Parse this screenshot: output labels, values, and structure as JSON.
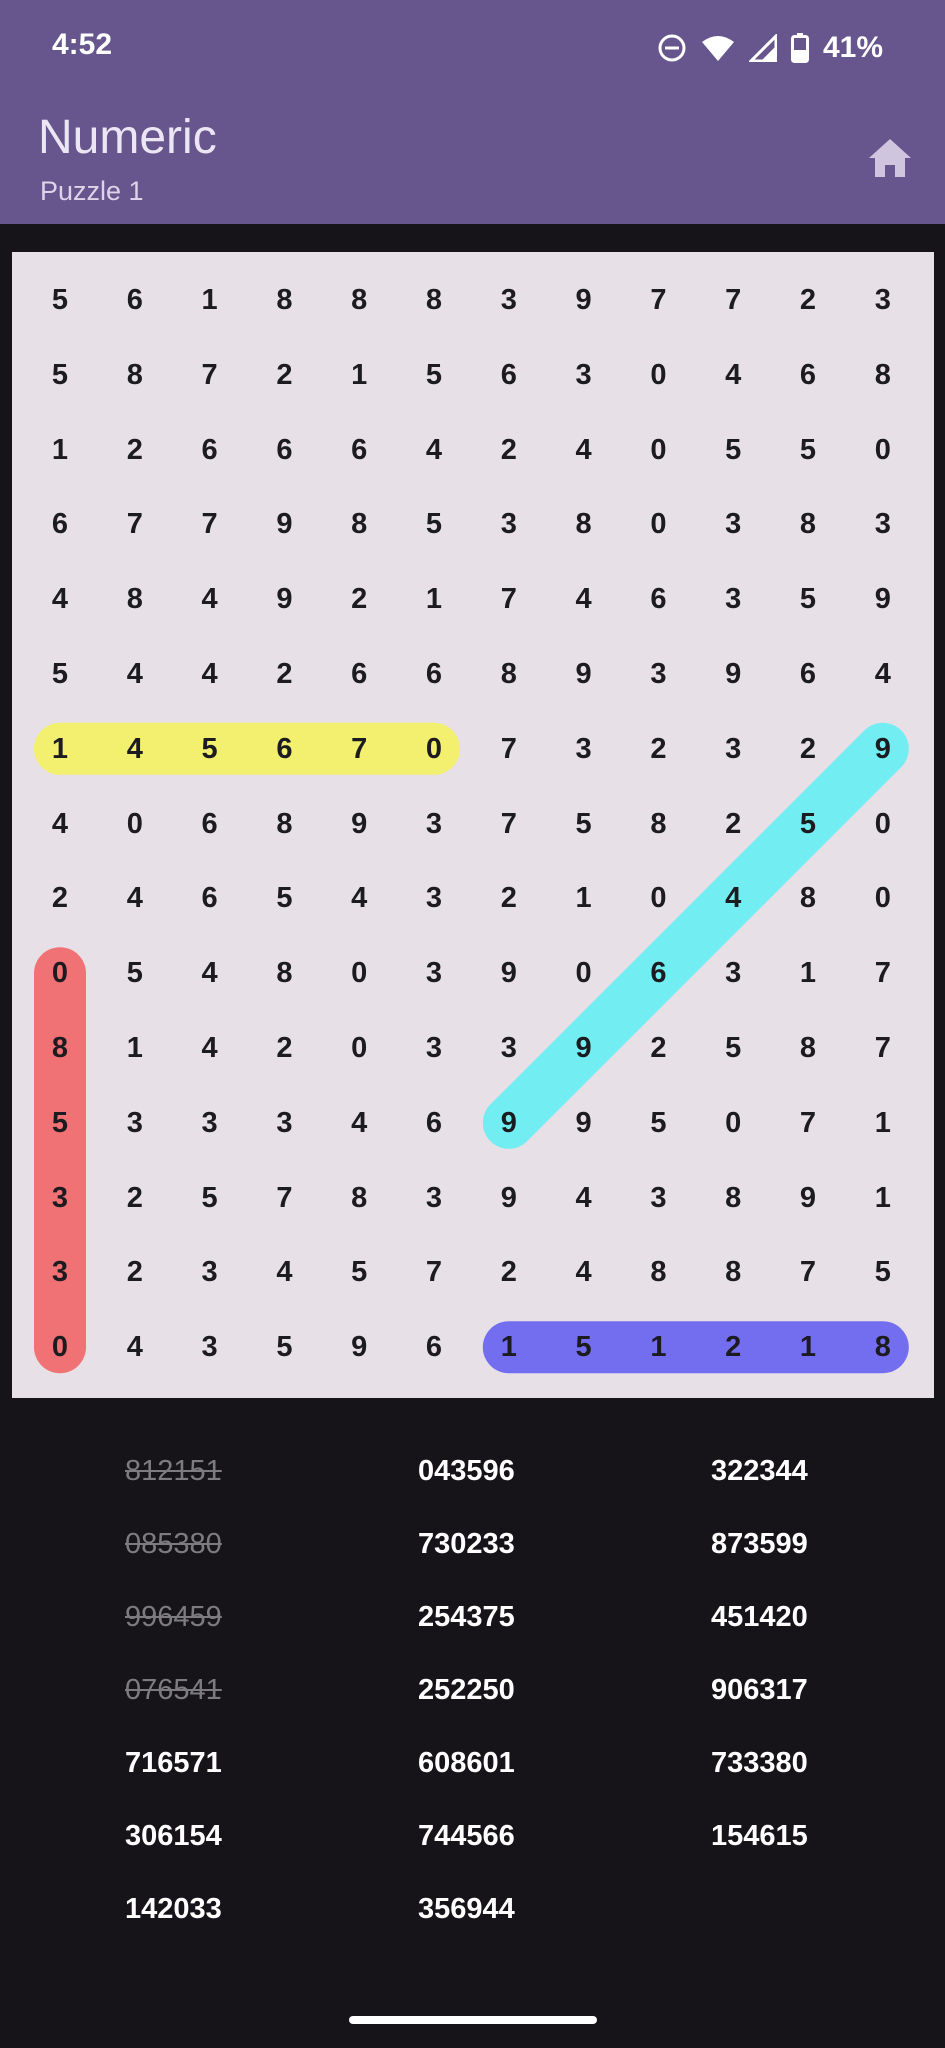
{
  "status_bar": {
    "time": "4:52",
    "battery": "41%"
  },
  "app_bar": {
    "title": "Numeric",
    "subtitle": "Puzzle 1",
    "home_icon": "home-icon"
  },
  "grid": {
    "rows": [
      "561888397723",
      "587215630468",
      "126664240550",
      "677985380383",
      "484921746359",
      "544266893964",
      "145670732329",
      "406893758250",
      "246543210480",
      "054803906317",
      "814203392587",
      "533346995071",
      "325783943891",
      "323457248875",
      "043596151218"
    ],
    "highlights": [
      {
        "word": "145670",
        "start": [
          6,
          0
        ],
        "end": [
          6,
          5
        ],
        "color": "#f2f06e"
      },
      {
        "word": "996459",
        "start": [
          11,
          6
        ],
        "end": [
          6,
          11
        ],
        "color": "#72eef2"
      },
      {
        "word": "085380",
        "start": [
          9,
          0
        ],
        "end": [
          14,
          0
        ],
        "color": "#f07274"
      },
      {
        "word": "151218",
        "start": [
          14,
          6
        ],
        "end": [
          14,
          11
        ],
        "color": "#736ef0"
      }
    ]
  },
  "words": [
    [
      {
        "text": "812151",
        "found": true
      },
      {
        "text": "085380",
        "found": true
      },
      {
        "text": "996459",
        "found": true
      },
      {
        "text": "076541",
        "found": true
      },
      {
        "text": "716571",
        "found": false
      },
      {
        "text": "306154",
        "found": false
      },
      {
        "text": "142033",
        "found": false
      }
    ],
    [
      {
        "text": "043596",
        "found": false
      },
      {
        "text": "730233",
        "found": false
      },
      {
        "text": "254375",
        "found": false
      },
      {
        "text": "252250",
        "found": false
      },
      {
        "text": "608601",
        "found": false
      },
      {
        "text": "744566",
        "found": false
      },
      {
        "text": "356944",
        "found": false
      }
    ],
    [
      {
        "text": "322344",
        "found": false
      },
      {
        "text": "873599",
        "found": false
      },
      {
        "text": "451420",
        "found": false
      },
      {
        "text": "906317",
        "found": false
      },
      {
        "text": "733380",
        "found": false
      },
      {
        "text": "154615",
        "found": false
      }
    ]
  ]
}
